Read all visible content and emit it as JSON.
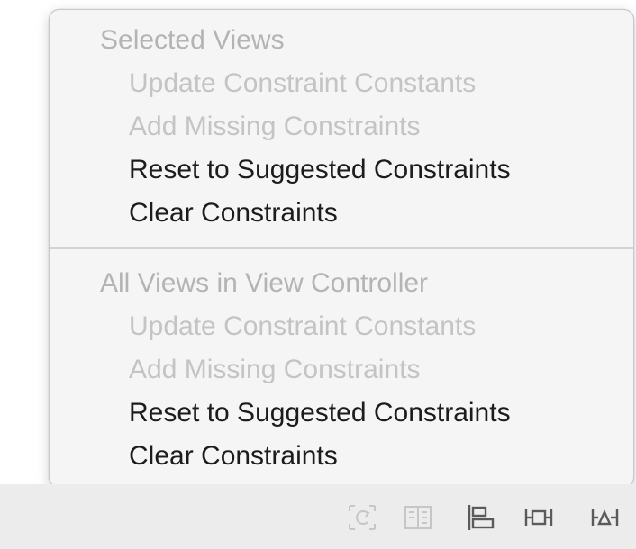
{
  "menu": {
    "sections": [
      {
        "header": "Selected Views",
        "items": [
          {
            "label": "Update Constraint Constants",
            "enabled": false
          },
          {
            "label": "Add Missing Constraints",
            "enabled": false
          },
          {
            "label": "Reset to Suggested Constraints",
            "enabled": true
          },
          {
            "label": "Clear Constraints",
            "enabled": true
          }
        ]
      },
      {
        "header": "All Views in View Controller",
        "items": [
          {
            "label": "Update Constraint Constants",
            "enabled": false
          },
          {
            "label": "Add Missing Constraints",
            "enabled": false
          },
          {
            "label": "Reset to Suggested Constraints",
            "enabled": true
          },
          {
            "label": "Clear Constraints",
            "enabled": true
          }
        ]
      }
    ]
  },
  "toolbar": {
    "icons": [
      {
        "name": "update-frames-icon",
        "enabled": false
      },
      {
        "name": "embed-in-stack-icon",
        "enabled": false
      },
      {
        "name": "align-icon",
        "enabled": true
      },
      {
        "name": "add-new-constraints-icon",
        "enabled": true
      },
      {
        "name": "resolve-auto-layout-issues-icon",
        "enabled": true
      }
    ]
  },
  "colors": {
    "menu_background": "#f5f5f5",
    "enabled_text": "#1c1c1c",
    "disabled_text": "#c4c4c4",
    "header_text": "#b4b4b4",
    "toolbar_background": "#ececec",
    "icon_enabled": "#5a5a5a",
    "icon_disabled": "#c6c6c6"
  }
}
